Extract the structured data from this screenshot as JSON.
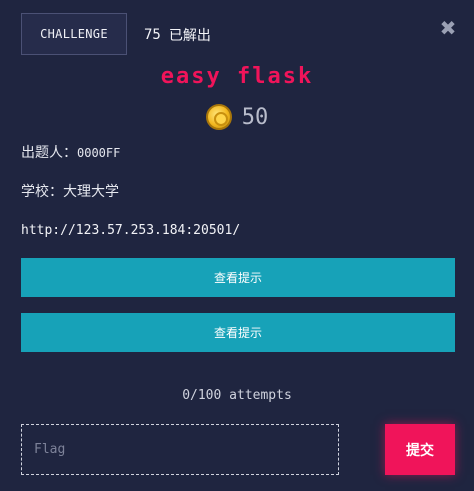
{
  "header": {
    "tab_label": "CHALLENGE",
    "solve_count": "75",
    "solve_suffix": "已解出",
    "close_glyph": "✖"
  },
  "challenge": {
    "name": "easy flask",
    "points": "50",
    "points_icon": "coin-icon",
    "author_label": "出题人：",
    "author": "0000FF",
    "school_label": "学校：",
    "school": "大理大学",
    "url": "http://123.57.253.184:20501/"
  },
  "hints": [
    {
      "label": "查看提示"
    },
    {
      "label": "查看提示"
    }
  ],
  "attempts": "0/100 attempts",
  "flag_form": {
    "placeholder": "Flag",
    "value": "",
    "submit_label": "提交"
  },
  "colors": {
    "background": "#1f2540",
    "accent": "#f0145a",
    "hint_button": "#17a2b8"
  }
}
